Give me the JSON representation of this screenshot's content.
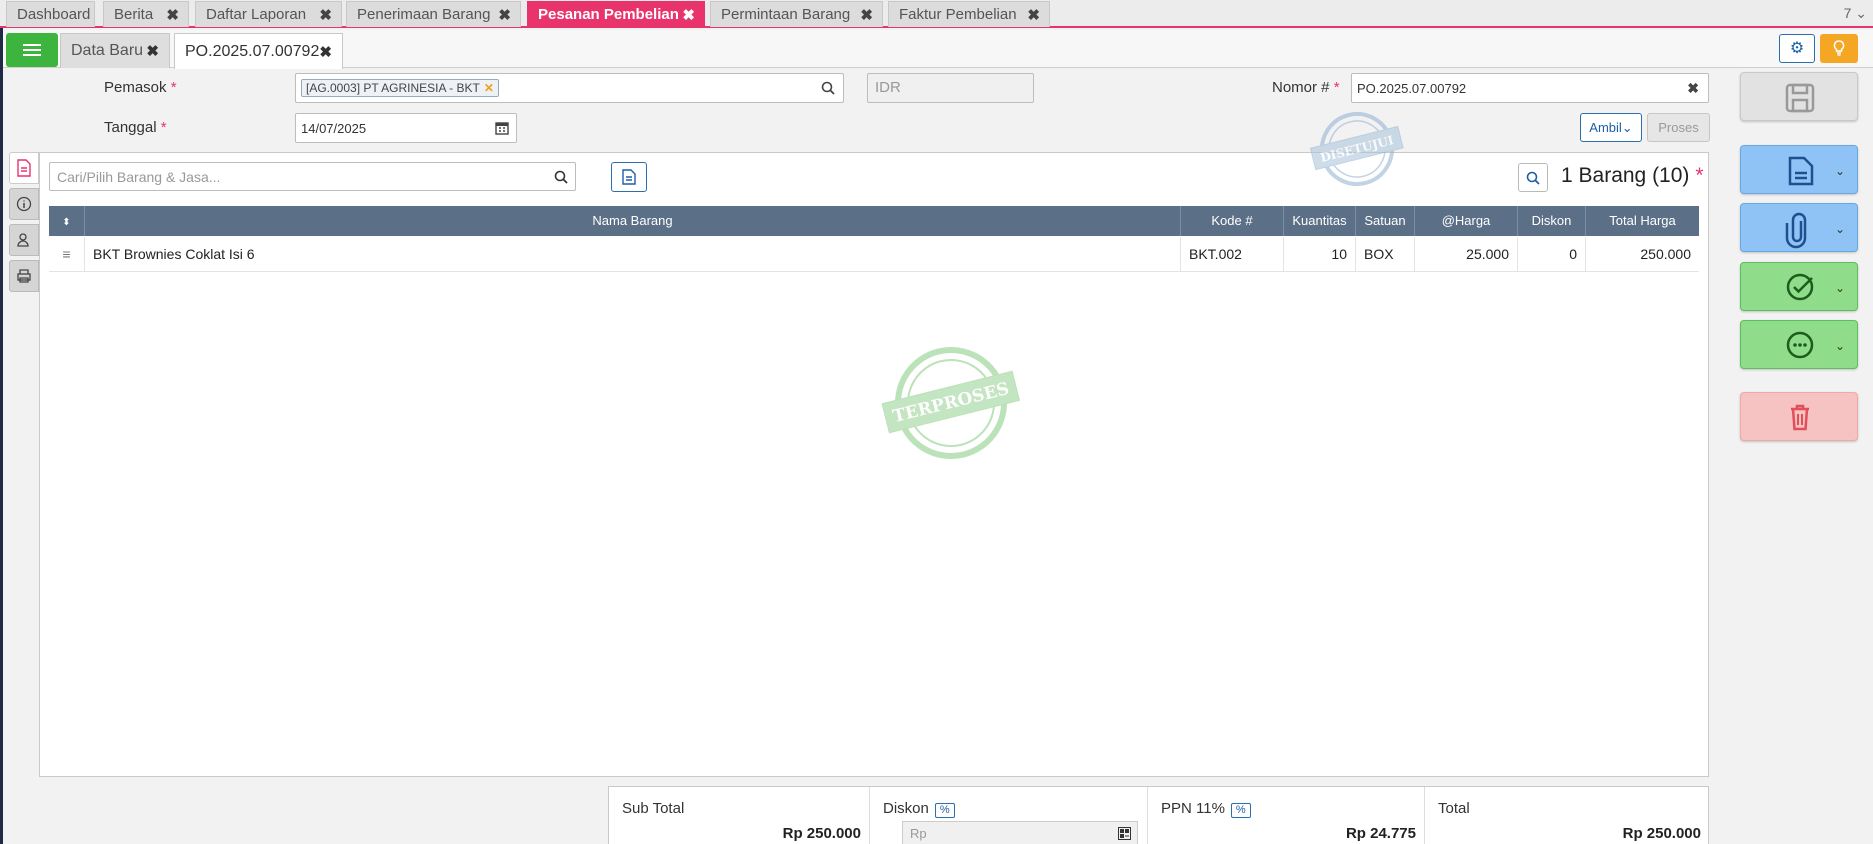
{
  "top_tabs": [
    {
      "label": "Dashboard"
    },
    {
      "label": "Berita"
    },
    {
      "label": "Daftar Laporan"
    },
    {
      "label": "Penerimaan Barang"
    },
    {
      "label": "Pesanan Pembelian"
    },
    {
      "label": "Permintaan Barang"
    },
    {
      "label": "Faktur Pembelian"
    }
  ],
  "tab_count": "7",
  "sub_tabs": [
    {
      "label": "Data Baru"
    },
    {
      "label": "PO.2025.07.00792"
    }
  ],
  "form": {
    "pemasok_label": "Pemasok",
    "pemasok_value": "[AG.0003] PT AGRINESIA - BKT",
    "currency": "IDR",
    "nomor_label": "Nomor #",
    "nomor_value": "PO.2025.07.00792",
    "tanggal_label": "Tanggal",
    "tanggal_value": "14/07/2025",
    "required_mark": "*",
    "ambil_label": "Ambil",
    "proses_label": "Proses"
  },
  "stamps": {
    "approved": "DISETUJUI",
    "processed": "TERPROSES"
  },
  "items": {
    "search_placeholder": "Cari/Pilih Barang & Jasa...",
    "count_label": "1 Barang (10)",
    "columns": {
      "name": "Nama Barang",
      "code": "Kode #",
      "qty": "Kuantitas",
      "unit": "Satuan",
      "price": "@Harga",
      "disc": "Diskon",
      "total": "Total Harga"
    },
    "rows": [
      {
        "name": "BKT Brownies Coklat Isi 6",
        "code": "BKT.002",
        "qty": "10",
        "unit": "BOX",
        "price": "25.000",
        "disc": "0",
        "total": "250.000"
      }
    ]
  },
  "summary": {
    "subtotal_label": "Sub Total",
    "subtotal_value": "Rp 250.000",
    "diskon_label": "Diskon",
    "pct_label": "%",
    "diskon_placeholder": "Rp",
    "ppn_label": "PPN 11%",
    "ppn_value": "Rp 24.775",
    "total_label": "Total",
    "total_value": "Rp 250.000"
  },
  "colors": {
    "accent": "#e8336d",
    "green": "#3db43d",
    "table_header": "#5b6f87",
    "blue": "#1e5ea6",
    "orange": "#f5a623"
  }
}
